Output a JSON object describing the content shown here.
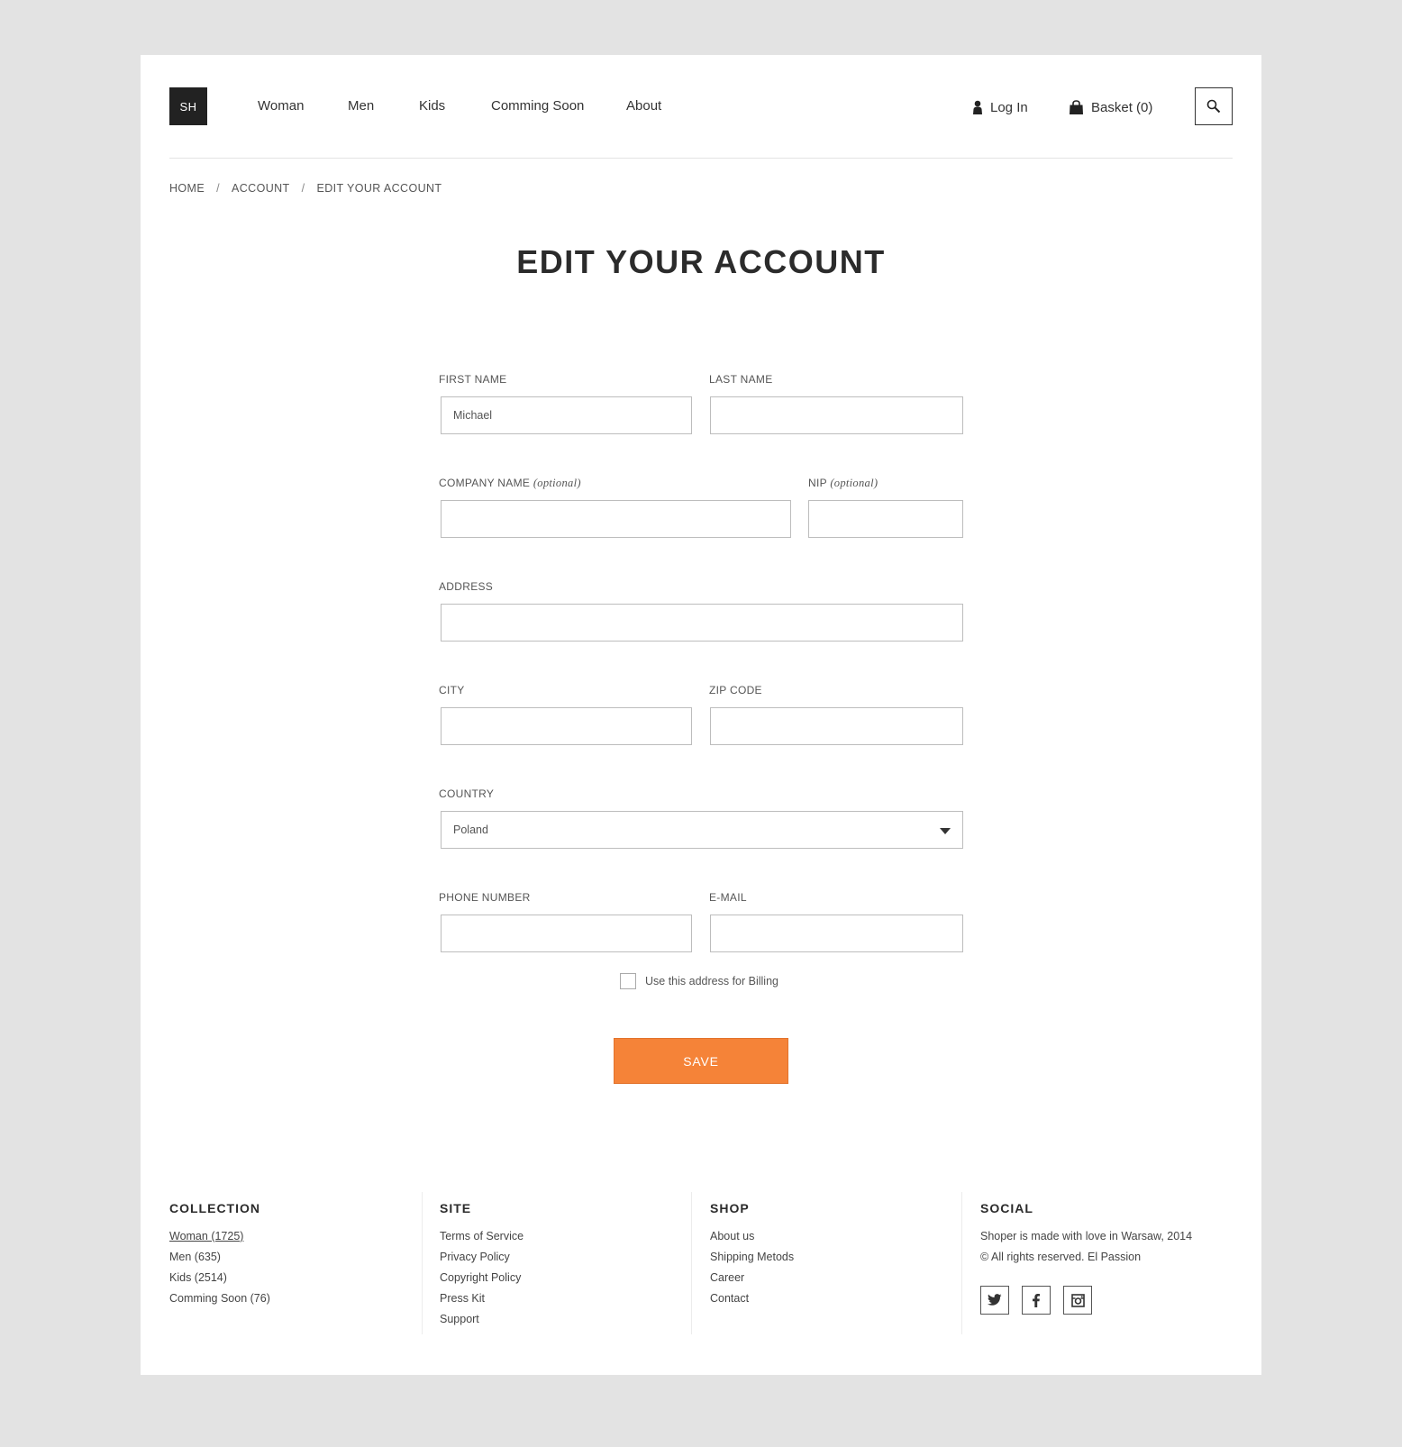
{
  "header": {
    "logo": "SH",
    "nav": [
      "Woman",
      "Men",
      "Kids",
      "Comming Soon",
      "About"
    ],
    "login": "Log In",
    "basket": "Basket (0)"
  },
  "breadcrumb": [
    "HOME",
    "ACCOUNT",
    "EDIT YOUR ACCOUNT"
  ],
  "breadcrumb_sep": "/",
  "page_title": "EDIT YOUR ACCOUNT",
  "form": {
    "first_name": {
      "label": "FIRST NAME",
      "value": "Michael"
    },
    "last_name": {
      "label": "LAST NAME",
      "value": ""
    },
    "company_name": {
      "label": "COMPANY NAME",
      "hint": "(optional)",
      "value": ""
    },
    "nip": {
      "label": "NIP",
      "hint": "(optional)",
      "value": ""
    },
    "address": {
      "label": "ADDRESS",
      "value": ""
    },
    "city": {
      "label": "CITY",
      "value": ""
    },
    "zip": {
      "label": "ZIP CODE",
      "value": ""
    },
    "country": {
      "label": "COUNTRY",
      "value": "Poland"
    },
    "phone": {
      "label": "PHONE NUMBER",
      "value": ""
    },
    "email": {
      "label": "E-MAIL",
      "value": ""
    },
    "billing_checkbox": {
      "label": "Use this address for Billing",
      "checked": false
    },
    "save": "SAVE"
  },
  "footer": {
    "collection": {
      "title": "COLLECTION",
      "items": [
        "Woman (1725)",
        "Men (635)",
        "Kids (2514)",
        "Comming Soon (76)"
      ]
    },
    "site": {
      "title": "SITE",
      "items": [
        "Terms of Service",
        "Privacy Policy",
        "Copyright Policy",
        "Press Kit",
        "Support"
      ]
    },
    "shop": {
      "title": "SHOP",
      "items": [
        "About us",
        "Shipping Metods",
        "Career",
        "Contact"
      ]
    },
    "social": {
      "title": "SOCIAL",
      "text": "Shoper is made with love in Warsaw, 2014 © All rights reserved. El Passion",
      "icons": [
        "twitter-icon",
        "facebook-icon",
        "instagram-icon"
      ]
    }
  },
  "colors": {
    "accent": "#f58338",
    "background": "#e3e3e3",
    "logo_bg": "#222222"
  }
}
